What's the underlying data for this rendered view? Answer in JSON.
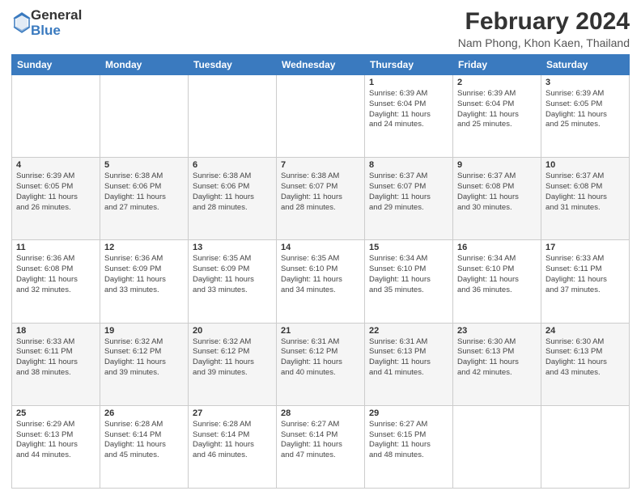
{
  "header": {
    "logo_general": "General",
    "logo_blue": "Blue",
    "month_title": "February 2024",
    "location": "Nam Phong, Khon Kaen, Thailand"
  },
  "days_of_week": [
    "Sunday",
    "Monday",
    "Tuesday",
    "Wednesday",
    "Thursday",
    "Friday",
    "Saturday"
  ],
  "weeks": [
    [
      {
        "day": "",
        "info": ""
      },
      {
        "day": "",
        "info": ""
      },
      {
        "day": "",
        "info": ""
      },
      {
        "day": "",
        "info": ""
      },
      {
        "day": "1",
        "info": "Sunrise: 6:39 AM\nSunset: 6:04 PM\nDaylight: 11 hours\nand 24 minutes."
      },
      {
        "day": "2",
        "info": "Sunrise: 6:39 AM\nSunset: 6:04 PM\nDaylight: 11 hours\nand 25 minutes."
      },
      {
        "day": "3",
        "info": "Sunrise: 6:39 AM\nSunset: 6:05 PM\nDaylight: 11 hours\nand 25 minutes."
      }
    ],
    [
      {
        "day": "4",
        "info": "Sunrise: 6:39 AM\nSunset: 6:05 PM\nDaylight: 11 hours\nand 26 minutes."
      },
      {
        "day": "5",
        "info": "Sunrise: 6:38 AM\nSunset: 6:06 PM\nDaylight: 11 hours\nand 27 minutes."
      },
      {
        "day": "6",
        "info": "Sunrise: 6:38 AM\nSunset: 6:06 PM\nDaylight: 11 hours\nand 28 minutes."
      },
      {
        "day": "7",
        "info": "Sunrise: 6:38 AM\nSunset: 6:07 PM\nDaylight: 11 hours\nand 28 minutes."
      },
      {
        "day": "8",
        "info": "Sunrise: 6:37 AM\nSunset: 6:07 PM\nDaylight: 11 hours\nand 29 minutes."
      },
      {
        "day": "9",
        "info": "Sunrise: 6:37 AM\nSunset: 6:08 PM\nDaylight: 11 hours\nand 30 minutes."
      },
      {
        "day": "10",
        "info": "Sunrise: 6:37 AM\nSunset: 6:08 PM\nDaylight: 11 hours\nand 31 minutes."
      }
    ],
    [
      {
        "day": "11",
        "info": "Sunrise: 6:36 AM\nSunset: 6:08 PM\nDaylight: 11 hours\nand 32 minutes."
      },
      {
        "day": "12",
        "info": "Sunrise: 6:36 AM\nSunset: 6:09 PM\nDaylight: 11 hours\nand 33 minutes."
      },
      {
        "day": "13",
        "info": "Sunrise: 6:35 AM\nSunset: 6:09 PM\nDaylight: 11 hours\nand 33 minutes."
      },
      {
        "day": "14",
        "info": "Sunrise: 6:35 AM\nSunset: 6:10 PM\nDaylight: 11 hours\nand 34 minutes."
      },
      {
        "day": "15",
        "info": "Sunrise: 6:34 AM\nSunset: 6:10 PM\nDaylight: 11 hours\nand 35 minutes."
      },
      {
        "day": "16",
        "info": "Sunrise: 6:34 AM\nSunset: 6:10 PM\nDaylight: 11 hours\nand 36 minutes."
      },
      {
        "day": "17",
        "info": "Sunrise: 6:33 AM\nSunset: 6:11 PM\nDaylight: 11 hours\nand 37 minutes."
      }
    ],
    [
      {
        "day": "18",
        "info": "Sunrise: 6:33 AM\nSunset: 6:11 PM\nDaylight: 11 hours\nand 38 minutes."
      },
      {
        "day": "19",
        "info": "Sunrise: 6:32 AM\nSunset: 6:12 PM\nDaylight: 11 hours\nand 39 minutes."
      },
      {
        "day": "20",
        "info": "Sunrise: 6:32 AM\nSunset: 6:12 PM\nDaylight: 11 hours\nand 39 minutes."
      },
      {
        "day": "21",
        "info": "Sunrise: 6:31 AM\nSunset: 6:12 PM\nDaylight: 11 hours\nand 40 minutes."
      },
      {
        "day": "22",
        "info": "Sunrise: 6:31 AM\nSunset: 6:13 PM\nDaylight: 11 hours\nand 41 minutes."
      },
      {
        "day": "23",
        "info": "Sunrise: 6:30 AM\nSunset: 6:13 PM\nDaylight: 11 hours\nand 42 minutes."
      },
      {
        "day": "24",
        "info": "Sunrise: 6:30 AM\nSunset: 6:13 PM\nDaylight: 11 hours\nand 43 minutes."
      }
    ],
    [
      {
        "day": "25",
        "info": "Sunrise: 6:29 AM\nSunset: 6:13 PM\nDaylight: 11 hours\nand 44 minutes."
      },
      {
        "day": "26",
        "info": "Sunrise: 6:28 AM\nSunset: 6:14 PM\nDaylight: 11 hours\nand 45 minutes."
      },
      {
        "day": "27",
        "info": "Sunrise: 6:28 AM\nSunset: 6:14 PM\nDaylight: 11 hours\nand 46 minutes."
      },
      {
        "day": "28",
        "info": "Sunrise: 6:27 AM\nSunset: 6:14 PM\nDaylight: 11 hours\nand 47 minutes."
      },
      {
        "day": "29",
        "info": "Sunrise: 6:27 AM\nSunset: 6:15 PM\nDaylight: 11 hours\nand 48 minutes."
      },
      {
        "day": "",
        "info": ""
      },
      {
        "day": "",
        "info": ""
      }
    ]
  ]
}
